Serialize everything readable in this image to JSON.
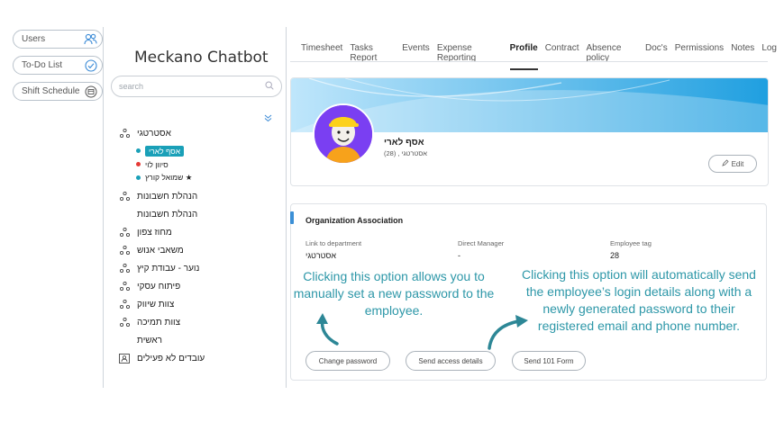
{
  "quick_buttons": [
    {
      "label": "Users",
      "icon": "users-icon"
    },
    {
      "label": "To-Do List",
      "icon": "check-circle-icon"
    },
    {
      "label": "Shift Schedule",
      "icon": "calendar-icon"
    }
  ],
  "sidebar": {
    "brand": "Meckano Chatbot",
    "search_placeholder": "search",
    "tree": [
      {
        "label": "אסטרטגי",
        "icon": "org-tree-icon"
      },
      {
        "label": "הנהלת חשבונות",
        "icon": "org-tree-icon"
      },
      {
        "label": "הנהלת חשבונות",
        "icon": ""
      },
      {
        "label": "מחוז צפון",
        "icon": "org-tree-icon"
      },
      {
        "label": "משאבי אנוש",
        "icon": "org-tree-icon"
      },
      {
        "label": "נוער - עבודת קיץ",
        "icon": "org-tree-icon"
      },
      {
        "label": "פיתוח עסקי",
        "icon": "org-tree-icon"
      },
      {
        "label": "צוות שיווק",
        "icon": "org-tree-icon"
      },
      {
        "label": "צוות תמיכה",
        "icon": "org-tree-icon"
      },
      {
        "label": "ראשית",
        "icon": ""
      },
      {
        "label": "עובדים לא פעילים",
        "icon": "inactive-users-icon"
      }
    ],
    "employees": [
      {
        "label": "אסף לארי",
        "dot_color": "#1aa0b8"
      },
      {
        "label": "סיוון לוי",
        "dot_color": "#e53935"
      },
      {
        "label": "שמואל קורץ ★",
        "dot_color": "#1aa0b8"
      }
    ]
  },
  "tabs": [
    "Timesheet",
    "Tasks Report",
    "Events",
    "Expense Reporting",
    "Profile",
    "Contract",
    "Absence policy",
    "Doc's",
    "Permissions",
    "Notes",
    "Log"
  ],
  "active_tab": "Profile",
  "profile": {
    "name": "אסף לארי",
    "subtitle": "אסטרטגי , (28)",
    "edit_label": "Edit"
  },
  "org": {
    "title": "Organization Association",
    "link_label": "Link to department",
    "link_value": "אסטרטגי",
    "manager_label": "Direct Manager",
    "manager_value": "-",
    "tag_label": "Employee tag",
    "tag_value": "28",
    "buttons": {
      "change_password": "Change password",
      "send_access": "Send access details",
      "send_101": "Send 101 Form"
    }
  },
  "annotations": {
    "left": "Clicking this option allows you to manually set a new password to the employee.",
    "right": "Clicking this option will automatically send the employee’s login details along with a newly generated password to their registered email and phone number."
  },
  "colors": {
    "accent": "#1aa0b8",
    "annotation": "#2d97a8"
  }
}
